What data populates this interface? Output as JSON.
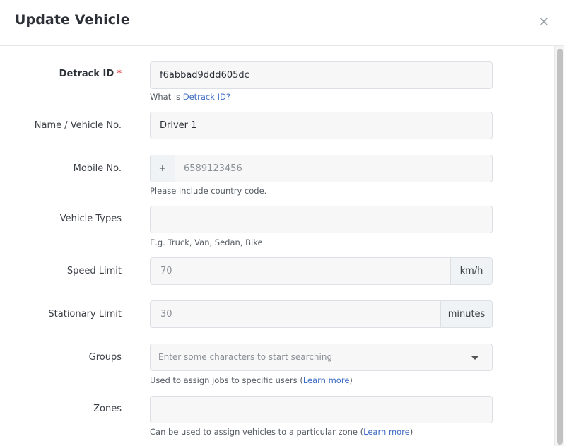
{
  "modal": {
    "title": "Update Vehicle",
    "close_icon": "close-icon",
    "close_glyph": "×"
  },
  "fields": {
    "detrack_id": {
      "label": "Detrack ID",
      "required_mark": "*",
      "value": "f6abbad9ddd605dc",
      "help_prefix": "What is ",
      "help_link": "Detrack ID?"
    },
    "name": {
      "label": "Name / Vehicle No.",
      "value": "Driver 1"
    },
    "mobile": {
      "label": "Mobile No.",
      "prefix": "+",
      "placeholder": "6589123456",
      "help": "Please include country code."
    },
    "vehicle_types": {
      "label": "Vehicle Types",
      "value": "",
      "help": "E.g. Truck, Van, Sedan, Bike"
    },
    "speed_limit": {
      "label": "Speed Limit",
      "value": "70",
      "unit": "km/h"
    },
    "stationary_limit": {
      "label": "Stationary Limit",
      "value": "30",
      "unit": "minutes"
    },
    "groups": {
      "label": "Groups",
      "placeholder": "Enter some characters to start searching",
      "help_prefix": "Used to assign jobs to specific users (",
      "help_link": "Learn more",
      "help_suffix": ")"
    },
    "zones": {
      "label": "Zones",
      "value": "",
      "help_prefix": "Can be used to assign vehicles to a particular zone (",
      "help_link": "Learn more",
      "help_suffix": ")"
    }
  },
  "colors": {
    "link": "#3d6bc4",
    "required": "#e5484d",
    "field_bg": "#f7f7f7",
    "border": "#dcdfe3"
  }
}
